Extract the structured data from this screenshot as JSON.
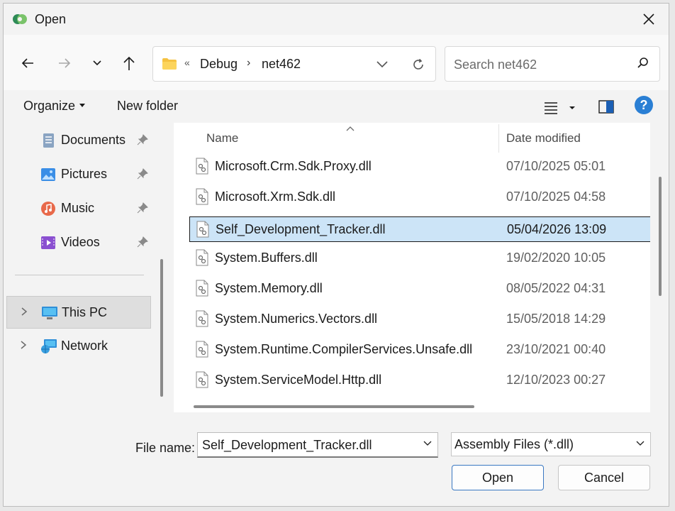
{
  "window": {
    "title": "Open"
  },
  "navigation": {
    "address": {
      "overflow_chevron": "«",
      "segments": [
        "Debug",
        "net462"
      ],
      "separator": "›"
    },
    "search": {
      "placeholder": "Search net462"
    }
  },
  "commandbar": {
    "organize_label": "Organize",
    "new_folder_label": "New folder"
  },
  "sidebar": {
    "quick_access": [
      {
        "label": "Documents",
        "icon": "documents-icon"
      },
      {
        "label": "Pictures",
        "icon": "pictures-icon"
      },
      {
        "label": "Music",
        "icon": "music-icon"
      },
      {
        "label": "Videos",
        "icon": "videos-icon"
      }
    ],
    "locations": [
      {
        "label": "This PC",
        "icon": "computer-icon",
        "selected": true
      },
      {
        "label": "Network",
        "icon": "network-icon",
        "selected": false
      }
    ]
  },
  "filelist": {
    "columns": {
      "name": "Name",
      "date": "Date modified"
    },
    "rows": [
      {
        "name": "Microsoft.Crm.Sdk.Proxy.dll",
        "date": "07/10/2025 05:01",
        "selected": false
      },
      {
        "name": "Microsoft.Xrm.Sdk.dll",
        "date": "07/10/2025 04:58",
        "selected": false
      },
      {
        "name": "Self_Development_Tracker.dll",
        "date": "05/04/2026 13:09",
        "selected": true
      },
      {
        "name": "System.Buffers.dll",
        "date": "19/02/2020 10:05",
        "selected": false
      },
      {
        "name": "System.Memory.dll",
        "date": "08/05/2022 04:31",
        "selected": false
      },
      {
        "name": "System.Numerics.Vectors.dll",
        "date": "15/05/2018 14:29",
        "selected": false
      },
      {
        "name": "System.Runtime.CompilerServices.Unsafe.dll",
        "date": "23/10/2021 00:40",
        "selected": false
      },
      {
        "name": "System.ServiceModel.Http.dll",
        "date": "12/10/2023 00:27",
        "selected": false
      }
    ]
  },
  "footer": {
    "filename_label": "File name:",
    "filename_value": "Self_Development_Tracker.dll",
    "filetype_value": "Assembly Files (*.dll)",
    "open_label": "Open",
    "cancel_label": "Cancel"
  },
  "colors": {
    "accent": "#2a7fd4",
    "selection": "#cce4f7",
    "folder": "#f5c242"
  }
}
